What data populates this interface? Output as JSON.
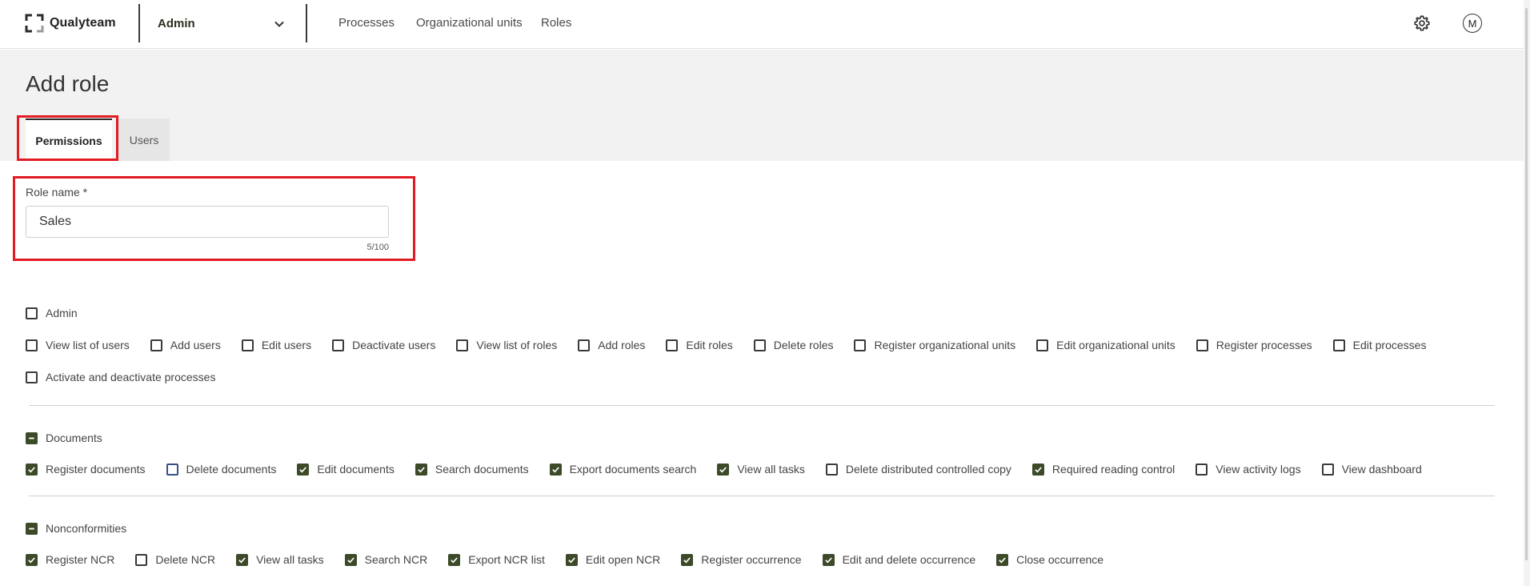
{
  "header": {
    "brand": "Qualyteam",
    "module_select": {
      "value": "Admin"
    },
    "nav": [
      "Processes",
      "Organizational units",
      "Roles"
    ],
    "avatar_initial": "M"
  },
  "page": {
    "title": "Add role",
    "tabs": [
      {
        "label": "Permissions",
        "active": true
      },
      {
        "label": "Users",
        "active": false
      }
    ]
  },
  "role_name": {
    "label": "Role name *",
    "value": "Sales",
    "counter": "5/100"
  },
  "groups": [
    {
      "label": "Admin",
      "state": "unchecked",
      "rows": [
        [
          {
            "label": "View list of users",
            "checked": false
          },
          {
            "label": "Add users",
            "checked": false
          },
          {
            "label": "Edit users",
            "checked": false
          },
          {
            "label": "Deactivate users",
            "checked": false
          },
          {
            "label": "View list of roles",
            "checked": false
          },
          {
            "label": "Add roles",
            "checked": false
          },
          {
            "label": "Edit roles",
            "checked": false
          },
          {
            "label": "Delete roles",
            "checked": false
          },
          {
            "label": "Register organizational units",
            "checked": false
          },
          {
            "label": "Edit organizational units",
            "checked": false
          },
          {
            "label": "Register processes",
            "checked": false
          },
          {
            "label": "Edit processes",
            "checked": false
          }
        ],
        [
          {
            "label": "Activate and deactivate processes",
            "checked": false
          }
        ]
      ]
    },
    {
      "label": "Documents",
      "state": "indeterminate",
      "rows": [
        [
          {
            "label": "Register documents",
            "checked": true
          },
          {
            "label": "Delete documents",
            "checked": false,
            "focused": true
          },
          {
            "label": "Edit documents",
            "checked": true
          },
          {
            "label": "Search documents",
            "checked": true
          },
          {
            "label": "Export documents search",
            "checked": true
          },
          {
            "label": "View all tasks",
            "checked": true
          },
          {
            "label": "Delete distributed controlled copy",
            "checked": false
          },
          {
            "label": "Required reading control",
            "checked": true
          },
          {
            "label": "View activity logs",
            "checked": false
          },
          {
            "label": "View dashboard",
            "checked": false
          }
        ]
      ]
    },
    {
      "label": "Nonconformities",
      "state": "indeterminate",
      "rows": [
        [
          {
            "label": "Register NCR",
            "checked": true
          },
          {
            "label": "Delete NCR",
            "checked": false
          },
          {
            "label": "View all tasks",
            "checked": true
          },
          {
            "label": "Search NCR",
            "checked": true
          },
          {
            "label": "Export NCR list",
            "checked": true
          },
          {
            "label": "Edit open NCR",
            "checked": true
          },
          {
            "label": "Register occurrence",
            "checked": true
          },
          {
            "label": "Edit and delete occurrence",
            "checked": true
          },
          {
            "label": "Close occurrence",
            "checked": true
          }
        ]
      ]
    }
  ],
  "colors": {
    "checkbox_checked": "#3d4a29",
    "highlight_box": "#e21b23",
    "title_band": "#f2f2f2"
  }
}
